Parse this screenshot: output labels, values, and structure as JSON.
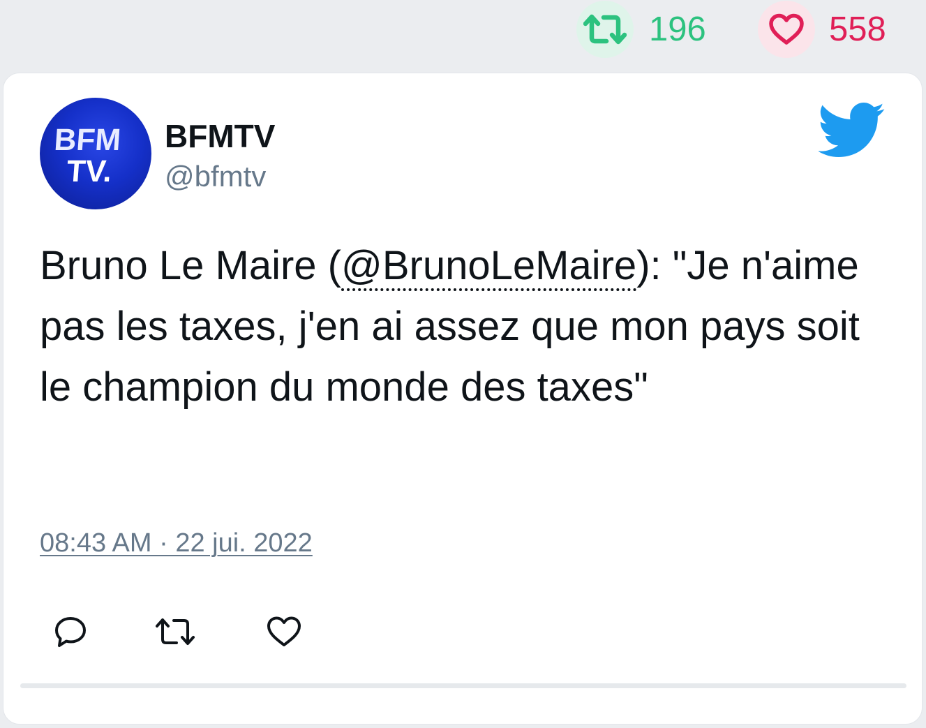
{
  "top_stats": {
    "retweet_icon": "retweet-icon",
    "retweet_count": "196",
    "like_icon": "heart-icon",
    "like_count": "558",
    "retweet_color": "#2cc27f",
    "like_color": "#e01f57"
  },
  "tweet": {
    "author": {
      "name": "BFMTV",
      "handle": "@bfmtv",
      "avatar_text_line1": "BFM",
      "avatar_text_line2": "TV."
    },
    "platform_icon": "twitter-bird-icon",
    "text_before": "Bruno Le Maire (",
    "mention": "@BrunoLeMaire",
    "text_after": "): \"Je n'aime pas les taxes, j'en ai assez que mon pays soit le champion du monde des taxes\"",
    "timestamp": "08:43 AM · 22 jui. 2022"
  },
  "actions": [
    {
      "name": "reply",
      "icon": "reply-icon"
    },
    {
      "name": "retweet",
      "icon": "retweet-icon"
    },
    {
      "name": "like",
      "icon": "heart-icon"
    }
  ],
  "colors": {
    "brand_blue": "#1d9bf0",
    "text": "#0f1419",
    "muted": "#66788a",
    "background": "#ebedf0"
  }
}
